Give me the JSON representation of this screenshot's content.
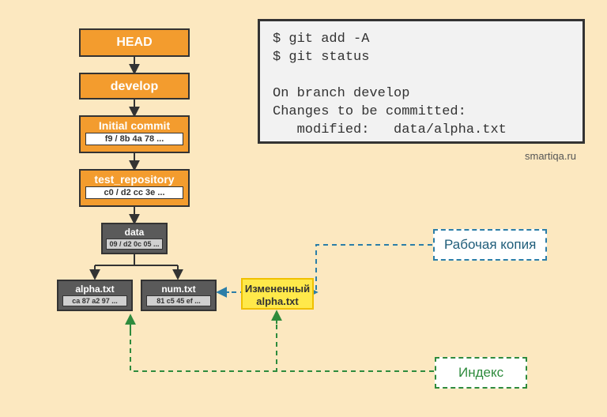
{
  "nodes": {
    "head": "HEAD",
    "develop": "develop",
    "initial_commit": {
      "title": "Initial commit",
      "hash": "f9 / 8b 4a 78 ..."
    },
    "test_repo": {
      "title": "test_repository",
      "hash": "c0 / d2 cc 3e ..."
    },
    "data": {
      "title": "data",
      "hash": "09 / d2 0c 05 ..."
    },
    "alpha": {
      "title": "alpha.txt",
      "hash": "ca 87 a2 97 ..."
    },
    "num": {
      "title": "num.txt",
      "hash": "81 c5 45 ef ..."
    },
    "changed": {
      "line1": "Измененный",
      "line2": "alpha.txt"
    }
  },
  "terminal": {
    "line1": "$ git add -A",
    "line2": "$ git status",
    "line3": "",
    "line4": "On branch develop",
    "line5": "Changes to be committed:",
    "line6": "   modified:   data/alpha.txt"
  },
  "labels": {
    "working_copy": "Рабочая копия",
    "index": "Индекс"
  },
  "credit": "smartiqa.ru",
  "colors": {
    "blue": "#2c7ea8",
    "green": "#2e8b3d"
  }
}
